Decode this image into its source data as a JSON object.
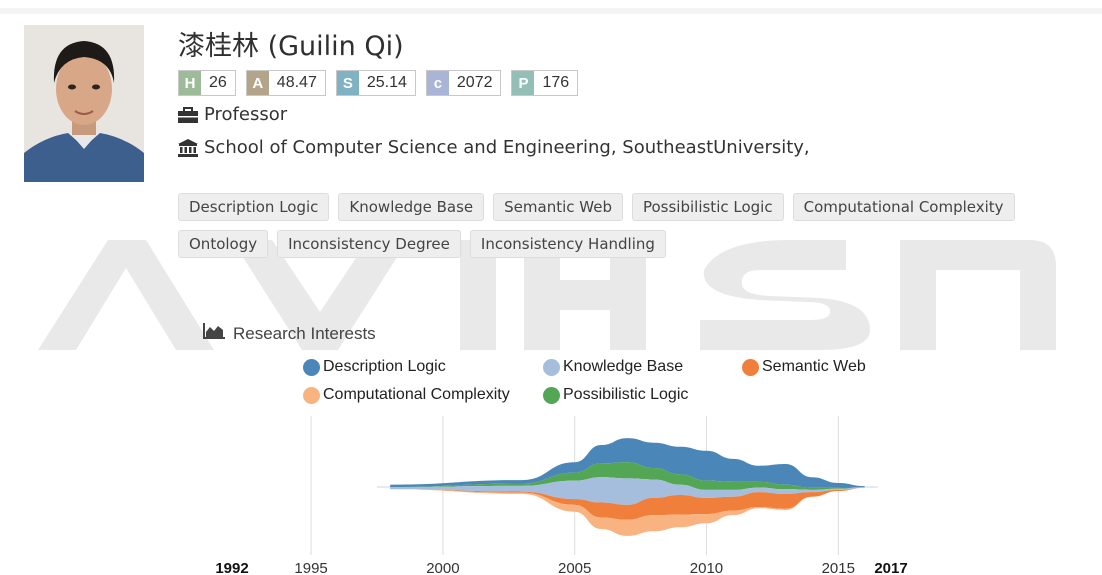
{
  "profile": {
    "name": "漆桂林 (Guilin Qi)",
    "metrics": [
      {
        "key": "H",
        "value": "26",
        "color": "#9dbb98"
      },
      {
        "key": "A",
        "value": "48.47",
        "color": "#b4a48a"
      },
      {
        "key": "S",
        "value": "25.14",
        "color": "#7fb2c3"
      },
      {
        "key": "c",
        "value": "2072",
        "color": "#a9b4d6"
      },
      {
        "key": "P",
        "value": "176",
        "color": "#93bfb6"
      }
    ],
    "position": "Professor",
    "position_icon": "briefcase-icon",
    "affiliation": "School of Computer Science and Engineering, SoutheastUniversity,",
    "affiliation_icon": "institution-icon"
  },
  "tags": [
    "Description Logic",
    "Knowledge Base",
    "Semantic Web",
    "Possibilistic Logic",
    "Computational Complexity",
    "Ontology",
    "Inconsistency Degree",
    "Inconsistency Handling"
  ],
  "interests": {
    "title": "Research Interests",
    "icon": "area-chart-icon"
  },
  "chart_data": {
    "type": "area",
    "subtype": "streamgraph",
    "x_start": 1992,
    "x_end": 2017,
    "xticks": [
      1995,
      2000,
      2005,
      2010,
      2015
    ],
    "grid": true,
    "series": [
      {
        "name": "Description Logic",
        "color": "#4b86b8",
        "x": [
          1998,
          2003,
          2005,
          2006,
          2007,
          2008,
          2009,
          2010,
          2011,
          2012,
          2013,
          2014,
          2015,
          2016
        ],
        "values": [
          0.2,
          0.3,
          0.9,
          1.6,
          2.1,
          2.2,
          2.4,
          2.6,
          2.0,
          1.4,
          1.8,
          0.9,
          0.4,
          0.1
        ]
      },
      {
        "name": "Knowledge Base",
        "color": "#a6bedd",
        "x": [
          1998,
          2003,
          2005,
          2006,
          2007,
          2008,
          2009,
          2010,
          2011,
          2012,
          2013,
          2014,
          2015,
          2016
        ],
        "values": [
          0.2,
          0.5,
          1.6,
          2.2,
          2.3,
          1.6,
          0.9,
          0.7,
          0.6,
          0.4,
          0.4,
          0.2,
          0.1,
          0.05
        ]
      },
      {
        "name": "Semantic Web",
        "color": "#f07f3c",
        "x": [
          1998,
          2003,
          2005,
          2006,
          2007,
          2008,
          2009,
          2010,
          2011,
          2012,
          2013,
          2014,
          2015,
          2016
        ],
        "values": [
          0.0,
          0.1,
          0.5,
          1.3,
          1.3,
          1.5,
          1.7,
          1.4,
          1.2,
          1.3,
          1.3,
          0.4,
          0.1,
          0.0
        ]
      },
      {
        "name": "Computational Complexity",
        "color": "#f9b381",
        "x": [
          1998,
          2003,
          2005,
          2006,
          2007,
          2008,
          2009,
          2010,
          2011,
          2012,
          2013,
          2014,
          2015,
          2016
        ],
        "values": [
          0.0,
          0.1,
          0.6,
          1.0,
          1.4,
          1.4,
          1.1,
          0.8,
          0.4,
          0.1,
          0.1,
          0.0,
          0.0,
          0.0
        ]
      },
      {
        "name": "Possibilistic Logic",
        "color": "#53a754",
        "x": [
          1998,
          2003,
          2005,
          2006,
          2007,
          2008,
          2009,
          2010,
          2011,
          2012,
          2013,
          2014,
          2015,
          2016
        ],
        "values": [
          0.0,
          0.2,
          0.7,
          1.2,
          1.4,
          1.0,
          0.9,
          0.8,
          0.7,
          0.5,
          0.4,
          0.2,
          0.1,
          0.0
        ]
      }
    ]
  }
}
